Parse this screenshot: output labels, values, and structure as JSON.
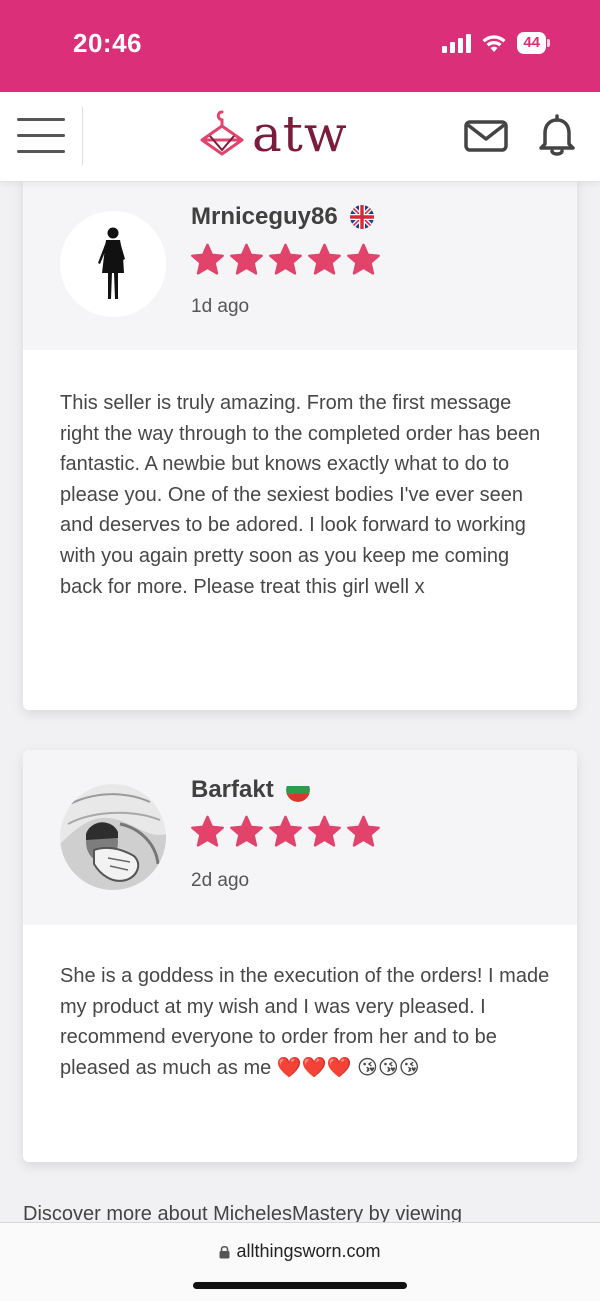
{
  "status_bar": {
    "time": "20:46",
    "battery": "44"
  },
  "header": {
    "logo_text": "atw"
  },
  "reviews": [
    {
      "name": "Mrniceguy86",
      "flag": "uk-flag-icon",
      "rating": 5,
      "time": "1d ago",
      "text": "This seller is truly amazing. From the first message right the way through to the completed order has been fantastic. A newbie but knows exactly what to do to please you. One of the sexiest bodies I've ever seen and deserves to be adored. I look forward to working with you again pretty soon as you keep me coming back for more. Please treat this girl well x"
    },
    {
      "name": "Barfakt",
      "flag": "bulgaria-flag-icon",
      "rating": 5,
      "time": "2d ago",
      "text": "She is a goddess in the execution of the orders! I made my product at my wish and I was very pleased. I recommend everyone to order from her and to be pleased as much as me ❤️❤️❤️ 😘😘😘"
    }
  ],
  "discover_text": "Discover more about MichelesMastery by viewing",
  "browser": {
    "url": "allthingsworn.com"
  },
  "colors": {
    "brand_pink": "#dc2f7a",
    "star": "#e2436b",
    "logo": "#7a1c3a"
  }
}
